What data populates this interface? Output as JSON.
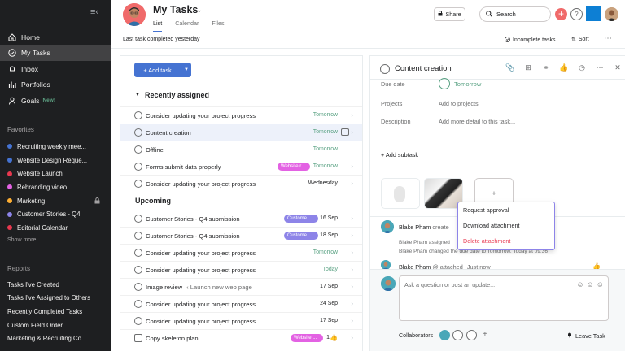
{
  "sidebar": {
    "nav": [
      {
        "label": "Home",
        "icon": "home-icon"
      },
      {
        "label": "My Tasks",
        "icon": "check-circle-icon",
        "active": true
      },
      {
        "label": "Inbox",
        "icon": "bell-icon"
      },
      {
        "label": "Portfolios",
        "icon": "bar-chart-icon"
      },
      {
        "label": "Goals",
        "icon": "person-icon",
        "badge": "New!"
      }
    ],
    "favorites_title": "Favorites",
    "favorites": [
      {
        "label": "Recruiting weekly mee...",
        "color": "#4573d2"
      },
      {
        "label": "Website Design Reque...",
        "color": "#4573d2"
      },
      {
        "label": "Website Launch",
        "color": "#e8384f"
      },
      {
        "label": "Rebranding video",
        "color": "#e362e3"
      },
      {
        "label": "Marketing",
        "color": "#fdae33",
        "locked": true
      },
      {
        "label": "Customer Stories - Q4",
        "color": "#8d84e8"
      },
      {
        "label": "Editorial Calendar",
        "color": "#e8384f"
      }
    ],
    "show_more": "Show more",
    "reports_title": "Reports",
    "reports": [
      "Tasks I've Created",
      "Tasks I've Assigned to Others",
      "Recently Completed Tasks",
      "Custom Field Order",
      "Marketing & Recruiting Co..."
    ]
  },
  "header": {
    "title": "My Tasks",
    "tabs": [
      "List",
      "Calendar",
      "Files"
    ],
    "share": "Share",
    "search": "Search",
    "help": "?",
    "plus": "+"
  },
  "subbar": {
    "last_completed": "Last task completed yesterday",
    "incomplete": "Incomplete tasks",
    "sort": "Sort",
    "more": "⋯"
  },
  "list": {
    "add_task": "Add task",
    "sections": [
      {
        "title": "Recently assigned"
      },
      {
        "title": "Upcoming"
      }
    ],
    "tasks": [
      {
        "name": "Consider updating your project progress",
        "due": "Tomorrow",
        "green": true
      },
      {
        "name": "Content creation",
        "due": "Tomorrow",
        "green": true,
        "selected": true
      },
      {
        "name": "Offline",
        "due": "Tomorrow",
        "green": true
      },
      {
        "name": "Forms submit data properly",
        "due": "Tomorrow",
        "green": true,
        "tag": "Website r..."
      },
      {
        "name": "Consider updating your project progress",
        "due": "Wednesday",
        "green": false
      },
      {
        "name": "Customer Stories - Q4 submission",
        "due": "16 Sep",
        "green": false,
        "tag": "Custome..."
      },
      {
        "name": "Customer Stories - Q4 submission",
        "due": "18 Sep",
        "green": false,
        "tag": "Custome..."
      },
      {
        "name": "Consider updating your project progress",
        "due": "Tomorrow",
        "green": true
      },
      {
        "name": "Consider updating your project progress",
        "due": "Today",
        "green": true
      },
      {
        "name": "Image review",
        "sub": "‹ Launch new web page",
        "due": "17 Sep",
        "green": false
      },
      {
        "name": "Consider updating your project progress",
        "due": "24 Sep",
        "green": false
      },
      {
        "name": "Consider updating your project progress",
        "due": "17 Sep",
        "green": false
      },
      {
        "name": "Copy skeleton plan",
        "due": "1",
        "green": false,
        "tag": "Website ..."
      }
    ]
  },
  "detail": {
    "title": "Content creation",
    "due_label": "Due date",
    "due_value": "Tomorrow",
    "projects_label": "Projects",
    "projects_value": "Add to projects",
    "description_label": "Description",
    "description_value": "Add more detail to this task...",
    "add_subtask": "Add subtask",
    "attach_plus": "+",
    "comments": [
      {
        "name": "Blake Pham",
        "action": "create"
      },
      {
        "text1": "Blake Pham assigned",
        "text2": "Blake Pham changed the due date to Tomorrow.   Today at 09:36"
      },
      {
        "name": "Blake Pham",
        "action": "@ attached",
        "time": "Just now"
      }
    ],
    "menu": [
      "Request approval",
      "Download attachment",
      "Delete attachment"
    ],
    "composer_placeholder": "Ask a question or post an update...",
    "collaborators": "Collaborators",
    "leave": "Leave Task"
  }
}
